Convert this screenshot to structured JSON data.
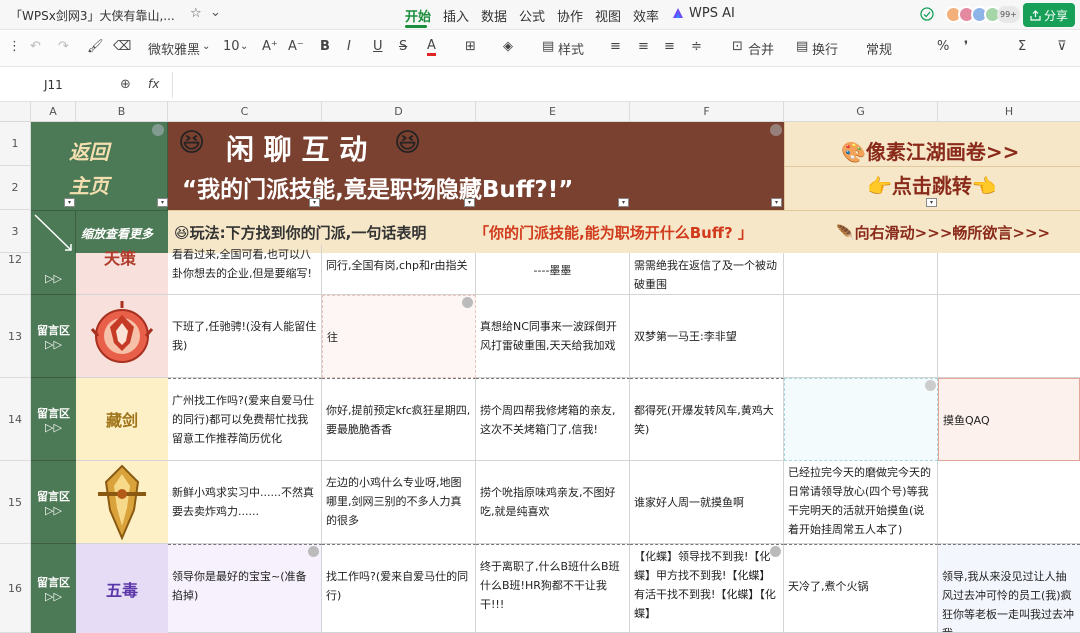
{
  "window": {
    "doc_title": "「WPSx剑网3」大侠有靠山,...",
    "star": "☆",
    "caret": "⌄"
  },
  "menus": [
    {
      "label": "开始"
    },
    {
      "label": "插入"
    },
    {
      "label": "数据"
    },
    {
      "label": "公式"
    },
    {
      "label": "协作"
    },
    {
      "label": "视图"
    },
    {
      "label": "效率"
    },
    {
      "label": "WPS AI"
    }
  ],
  "collab": {
    "count": "99+",
    "share_label": "分享"
  },
  "toolbar": {
    "font_name": "微软雅黑",
    "font_size": "10",
    "style_label": "样式",
    "merge_label": "合并",
    "wrap_label": "换行",
    "format_label": "常规"
  },
  "formula": {
    "cell_ref": "J11",
    "fx": "fx"
  },
  "columns": [
    "A",
    "B",
    "C",
    "D",
    "E",
    "F",
    "G",
    "H"
  ],
  "rows": [
    "1",
    "2",
    "3",
    "12",
    "13",
    "14",
    "15",
    "16"
  ],
  "header": {
    "back_line1": "返回",
    "back_line2": "主页",
    "title_main": "闲 聊 互 动",
    "title_quote": "“我的门派技能,竟是职场隐藏Buff?!”",
    "pixel_link": "🎨像素江湖画卷>>",
    "click_jump": "👉点击跳转👈",
    "zoom_more": "缩放查看更多",
    "rule_prefix": "😆玩法:下方找到你的门派,一句话表明",
    "rule_quote": "「你的门派技能,能为职场开什么Buff? 」",
    "scroll_hint": "🪶向右滑动>>>畅所欲言>>>"
  },
  "row_label": {
    "line1": "留言区",
    "line2": "▷▷"
  },
  "sects": {
    "r12": "天策",
    "r14": "藏剑",
    "r16": "五毒"
  },
  "cells": {
    "r12c": "看看过来,全国可看,也可以八卦你想去的企业,但是要缩写!",
    "r12d": "同行,全国有岗,chp和r由指关",
    "r12e": "----墨墨",
    "r12f": "需需绝我在返信了及一个被动破重围",
    "r13c": "下班了,任驰骋!(没有人能留住我)",
    "r13d": "往",
    "r13e": "真想给NC同事来一波踩倒开风打雷破重围,天天给我加戏",
    "r13f": "双梦第一马王:李非望",
    "r14c": "广州找工作吗?(爱来自爱马仕的同行)都可以免费帮忙找我留意工作推荐简历优化",
    "r14d": "你好,提前预定kfc疯狂星期四,要最脆脆香香",
    "r14e": "捞个周四帮我修烤箱的亲友,这次不关烤箱门了,信我!",
    "r14f": "都得死(开爆发转风车,黄鸡大笑)",
    "r14h": "摸鱼QAQ",
    "r15c": "新鲜小鸡求实习中......不然真要去卖炸鸡力......",
    "r15d": "左边的小鸡什么专业呀,地图哪里,剑网三别的不多人力真的很多",
    "r15e": "捞个吮指原味鸡亲友,不图好吃,就是纯喜欢",
    "r15f": "谁家好人周一就摸鱼啊",
    "r15g": "已经拉完今天的磨做完今天的日常请领导放心(四个号)等我干完明天的活就开始摸鱼(说着开始挂周常五人本了)",
    "r16c": "领导你是最好的宝宝~(准备掐掉)",
    "r16d": "找工作吗?(爱来自爱马仕的同行)",
    "r16e": "终于离职了,什么B班什么B班什么B班!HR狗都不干让我干!!!",
    "r16f": "【化蝶】领导找不到我!【化蝶】甲方找不到我!【化蝶】有活干找不到我!【化蝶】【化蝶】",
    "r16g": "天冷了,煮个火锅",
    "r16h": "领导,我从来没见过让人抽风过去冲可怜的员工(我)疯狂你等老板一走叫我过去冲我一"
  },
  "colors": {
    "accent": "#1a8e3d",
    "header_green": "#4d7a56",
    "header_brown": "#7a4130"
  }
}
